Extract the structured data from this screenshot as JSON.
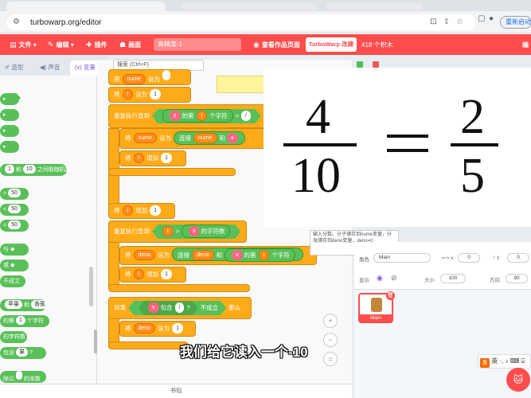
{
  "browser": {
    "url": "turbowarp.org/editor",
    "profile_label": "重新启动",
    "icons": [
      "tune-icon",
      "translate-icon",
      "share-icon",
      "bookmark-star-icon",
      "sidebar-icon",
      "profile-icon",
      "menu-icon"
    ]
  },
  "menubar": {
    "file": "文件",
    "edit": "编辑",
    "addons": "插件",
    "theme": "画面",
    "project_title": "高精度-1",
    "project_page": "查看作品页面",
    "turbowarp_btn": "TurboWarp 改建",
    "points": "418 个积木",
    "right_item": "编"
  },
  "tabs": {
    "costumes": "造型",
    "sounds": "声音",
    "variables": "变量"
  },
  "palette": {
    "random_from": "1",
    "random_to": "10",
    "random_label": "之间取随机数",
    "gt_val": "50",
    "lt_val": "50",
    "eq_val": "50",
    "and_label": "与",
    "or_label": "或",
    "not_label": "不成立",
    "join_a": "苹果",
    "join_label": "和",
    "join_b": "香蕉",
    "letter_of": "的第",
    "letter_num": "1",
    "letter_tail": "个字符",
    "length_label": "的字符数",
    "contains_label": "包含",
    "contains_b": "果",
    "mod_label": "除以",
    "mod_tail": "的余数"
  },
  "workspace": {
    "search_placeholder": "搜索 (Ctrl+F)",
    "blocks": {
      "set1_head": "将",
      "set1_var": "nume",
      "set1_to": "设为",
      "set2_head": "将",
      "set2_var": "i",
      "set2_to": "设为",
      "set2_val": "1",
      "repeat_until": "重复执行直到",
      "cond_x": "x",
      "cond_of": "的第",
      "cond_i": "i",
      "cond_char": "个字符",
      "cond_eq": "=",
      "inner_set_head": "将",
      "inner_set_var": "nume",
      "inner_set_to": "设为",
      "join_label": "连接",
      "join_a": "nume",
      "join_and": "和",
      "join_b": "x",
      "inc_head": "将",
      "inc_var": "i",
      "inc_label": "增加",
      "inc_val": "1",
      "inc2_head": "将",
      "inc2_var": "i",
      "inc2_label": "增加",
      "inc2_val": "1",
      "repeat2": "重复执行直到",
      "cond2_i": "i",
      "cond2_gt": ">",
      "cond2_x": "x",
      "cond2_len": "的字符数",
      "deno_set_head": "将",
      "deno_var": "deno",
      "deno_to": "设为",
      "deno_join": "连接",
      "deno_a": "deno",
      "deno_and": "和",
      "deno_x": "x",
      "deno_of": "的第",
      "deno_i": "i",
      "deno_char": "个字符",
      "inc3_head": "将",
      "inc3_var": "i",
      "inc3_label": "增加",
      "inc3_val": "1",
      "if_label": "如果",
      "if_x": "x",
      "if_contains": "包含",
      "if_slash": "/",
      "if_not": "不成立",
      "if_then": "那么",
      "else_set_head": "将",
      "else_deno": "deno",
      "else_to": "设为",
      "else_val": "1"
    },
    "comment_tooltip": "输入分数。分子储存到nume变量，分母储存到deno变量，deno=0"
  },
  "stage": {
    "left_num": "4",
    "left_den": "10",
    "right_num": "2",
    "right_den": "5"
  },
  "sprite_info": {
    "sprite_label": "角色",
    "sprite_name": "Main",
    "x_label": "x",
    "x_val": "0",
    "y_label": "y",
    "y_val": "0",
    "show_label": "显示",
    "size_label": "大小",
    "size_val": "100",
    "dir_label": "方向",
    "dir_val": "90",
    "sprite_card_name": "Main"
  },
  "backpack": "书包",
  "subtitle": "我们给它读入一个-10",
  "ime": {
    "logo": "S",
    "text": "英 ·, ♪ ⌨ ⌸"
  },
  "colors": {
    "turbowarp_red": "#ff4c4c",
    "control_orange": "#ffab19",
    "operator_green": "#59c059",
    "variable_orange": "#ff8c1a"
  }
}
